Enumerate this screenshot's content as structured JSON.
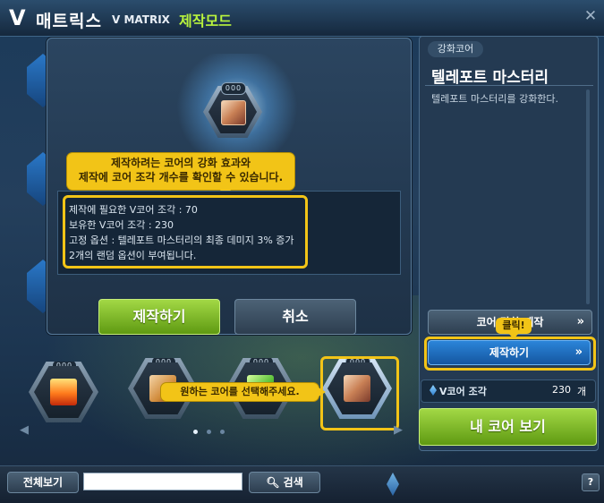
{
  "window": {
    "title_v": "V",
    "title_main": "매트릭스",
    "title_en": "V MATRIX",
    "mode": "제작모드",
    "close_glyph": "✕"
  },
  "modal": {
    "core_level": "000",
    "tooltip": {
      "line1": "제작하려는 코어의 강화 효과와",
      "line2": "제작에 코어 조각 개수를 확인할 수 있습니다."
    },
    "info_lines": [
      "제작에 필요한 V코어 조각 : 70",
      "보유한 V코어 조각 : 230",
      "고정 옵션 : 텔레포트 마스터리의 최종 데미지 3% 증가",
      "2개의 랜덤 옵션이 부여됩니다."
    ],
    "make_label": "제작하기",
    "cancel_label": "취소"
  },
  "core_grid": {
    "levels": [
      "000",
      "000",
      "000",
      "000"
    ],
    "tooltip": "원하는 코어를 선택해주세요.",
    "prev_glyph": "◀",
    "next_glyph": "▶"
  },
  "right_panel": {
    "tag": "강화코어",
    "core_name": "텔레포트 마스터리",
    "core_desc": "텔레포트 마스터리를 강화한다.",
    "upgrade_label": "코어 강화/제작",
    "click_tip": "클릭!",
    "make_label": "제작하기",
    "chevron": "»",
    "shard_label": "V코어 조각",
    "shard_count": "230",
    "shard_unit": "개",
    "my_core_label": "내 코어 보기"
  },
  "bottom": {
    "view_all": "전체보기",
    "search_value": "",
    "search_label": "검색",
    "help": "?"
  }
}
